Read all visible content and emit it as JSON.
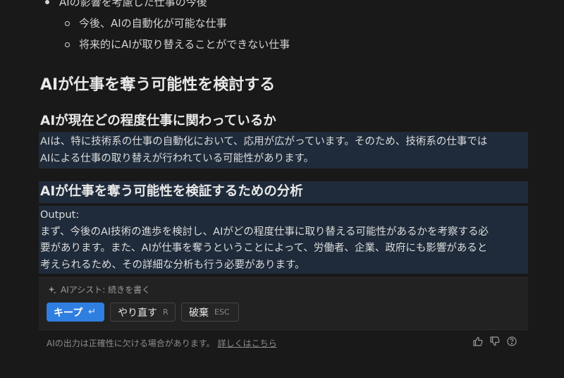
{
  "bullets": {
    "level1": "AIの影響を考慮した仕事の今後",
    "level2": [
      "今後、AIの自動化が可能な仕事",
      "将来的にAIが取り替えることができない仕事"
    ]
  },
  "heading2": "AIが仕事を奪う可能性を検討する",
  "section1": {
    "heading": "AIが現在どの程度仕事に関わっているか",
    "lines": [
      "AIは、特に技術系の仕事の自動化において、応用が広がっています。そのため、技術系の仕事では",
      "AIによる仕事の取り替えが行われている可能性があります。"
    ]
  },
  "section2": {
    "heading": "AIが仕事を奪う可能性を検証するための分析",
    "lines": [
      "Output:",
      "まず、今後のAI技術の進歩を検討し、AIがどの程度仕事に取り替える可能性があるかを考察する必",
      "要があります。また、AIが仕事を奪うということによって、労働者、企業、政府にも影響があると",
      "考えられるため、その詳細な分析も行う必要があります。"
    ]
  },
  "assist": {
    "label": "AIアシスト: 続きを書く",
    "keep_label": "キープ",
    "keep_key": "↵",
    "redo_label": "やり直す",
    "redo_key": "R",
    "discard_label": "破棄",
    "discard_key": "ESC"
  },
  "footer": {
    "disclaimer": "AIの出力は正確性に欠ける場合があります。",
    "link": "詳しくはこちら"
  },
  "colors": {
    "background": "#191919",
    "highlight": "#1f2b3a",
    "accent": "#2f7fe0"
  },
  "icons": [
    "sparkle-icon",
    "thumbs-up-icon",
    "thumbs-down-icon",
    "help-icon"
  ]
}
